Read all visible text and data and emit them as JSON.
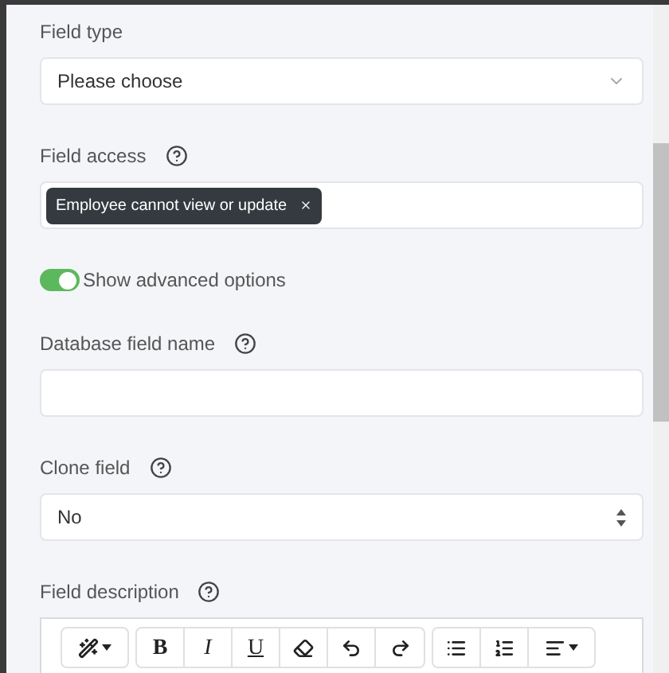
{
  "fields": [
    {
      "kind": "select",
      "label": "Field type",
      "value": "Please choose"
    },
    {
      "kind": "tags",
      "label": "Field access",
      "help": true,
      "tags": [
        "Employee cannot view or update"
      ]
    },
    {
      "kind": "toggle",
      "label": "Show advanced options",
      "on": true
    },
    {
      "kind": "input",
      "label": "Database field name",
      "help": true
    },
    {
      "kind": "select",
      "label": "Clone field",
      "help": true,
      "value": "No"
    },
    {
      "kind": "editor",
      "label": "Field description",
      "help": true,
      "toolbar": [
        [
          {
            "kind": "icon",
            "dropdown": true
          }
        ],
        [
          {
            "kind": "text",
            "label": "B"
          },
          {
            "kind": "text",
            "label": "I"
          },
          {
            "kind": "text",
            "label": "U"
          },
          {
            "kind": "icon",
            "dropdown": false
          },
          {
            "kind": "icon",
            "dropdown": false
          },
          {
            "kind": "icon",
            "dropdown": false
          }
        ],
        [
          {
            "kind": "icon",
            "dropdown": false
          },
          {
            "kind": "icon",
            "dropdown": false
          },
          {
            "kind": "icon",
            "dropdown": true
          }
        ]
      ]
    }
  ]
}
